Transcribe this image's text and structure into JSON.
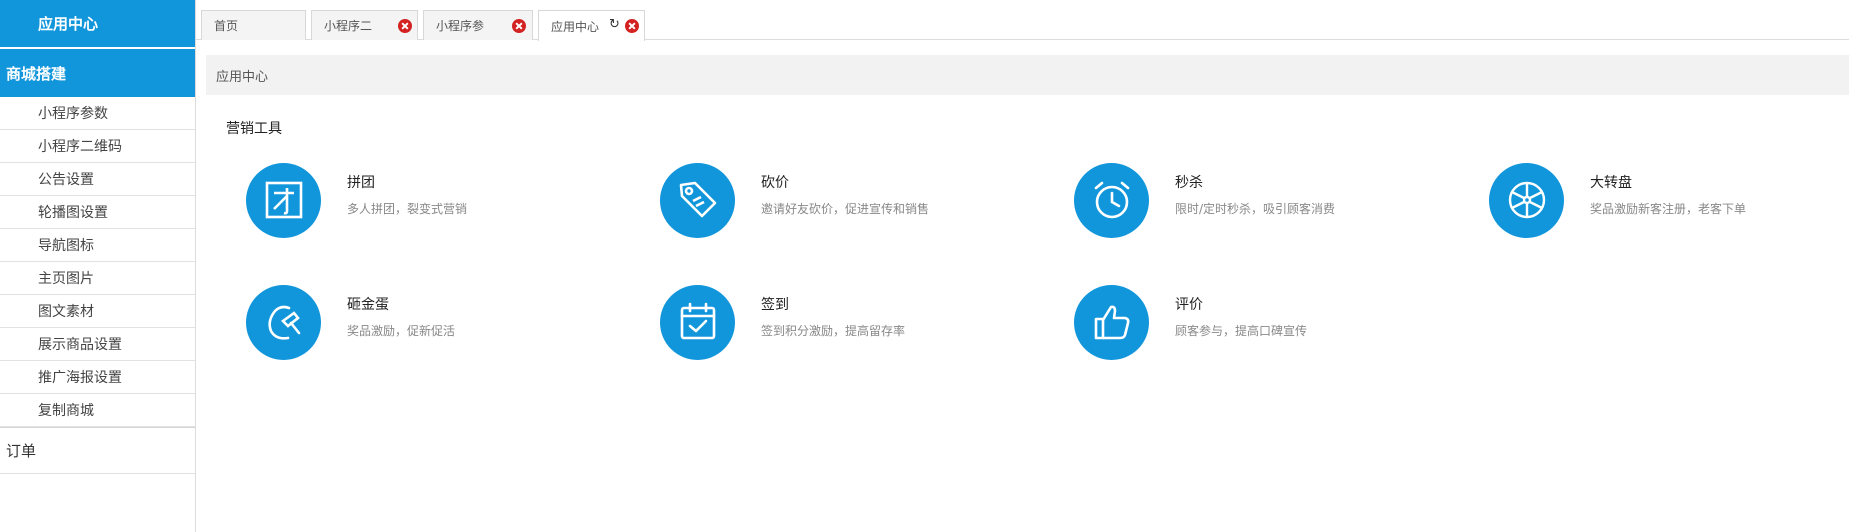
{
  "sidebar": {
    "top_title": "应用中心",
    "section_title": "商城搭建",
    "items": [
      {
        "label": "小程序参数"
      },
      {
        "label": "小程序二维码"
      },
      {
        "label": "公告设置"
      },
      {
        "label": "轮播图设置"
      },
      {
        "label": "导航图标"
      },
      {
        "label": "主页图片"
      },
      {
        "label": "图文素材"
      },
      {
        "label": "展示商品设置"
      },
      {
        "label": "推广海报设置"
      },
      {
        "label": "复制商城"
      }
    ],
    "section2_title": "订单"
  },
  "tabs": [
    {
      "label": "首页",
      "closable": false
    },
    {
      "label": "小程序二",
      "closable": true
    },
    {
      "label": "小程序参",
      "closable": true
    },
    {
      "label": "应用中心",
      "closable": true,
      "active": true
    }
  ],
  "breadcrumb": "应用中心",
  "section_title": "营销工具",
  "tools": [
    {
      "name": "拼团",
      "desc": "多人拼团，裂变式营销",
      "icon": "group-buy-icon"
    },
    {
      "name": "砍价",
      "desc": "邀请好友砍价，促进宣传和销售",
      "icon": "price-tag-icon"
    },
    {
      "name": "秒杀",
      "desc": "限时/定时秒杀，吸引顾客消费",
      "icon": "alarm-clock-icon"
    },
    {
      "name": "大转盘",
      "desc": "奖品激励新客注册，老客下单",
      "icon": "wheel-icon"
    },
    {
      "name": "砸金蛋",
      "desc": "奖品激励，促新促活",
      "icon": "hammer-egg-icon"
    },
    {
      "name": "签到",
      "desc": "签到积分激励，提高留存率",
      "icon": "calendar-check-icon"
    },
    {
      "name": "评价",
      "desc": "顾客参与，提高口碑宣传",
      "icon": "thumbs-up-icon"
    }
  ],
  "colors": {
    "brand": "#1296db",
    "close": "#d32222"
  }
}
